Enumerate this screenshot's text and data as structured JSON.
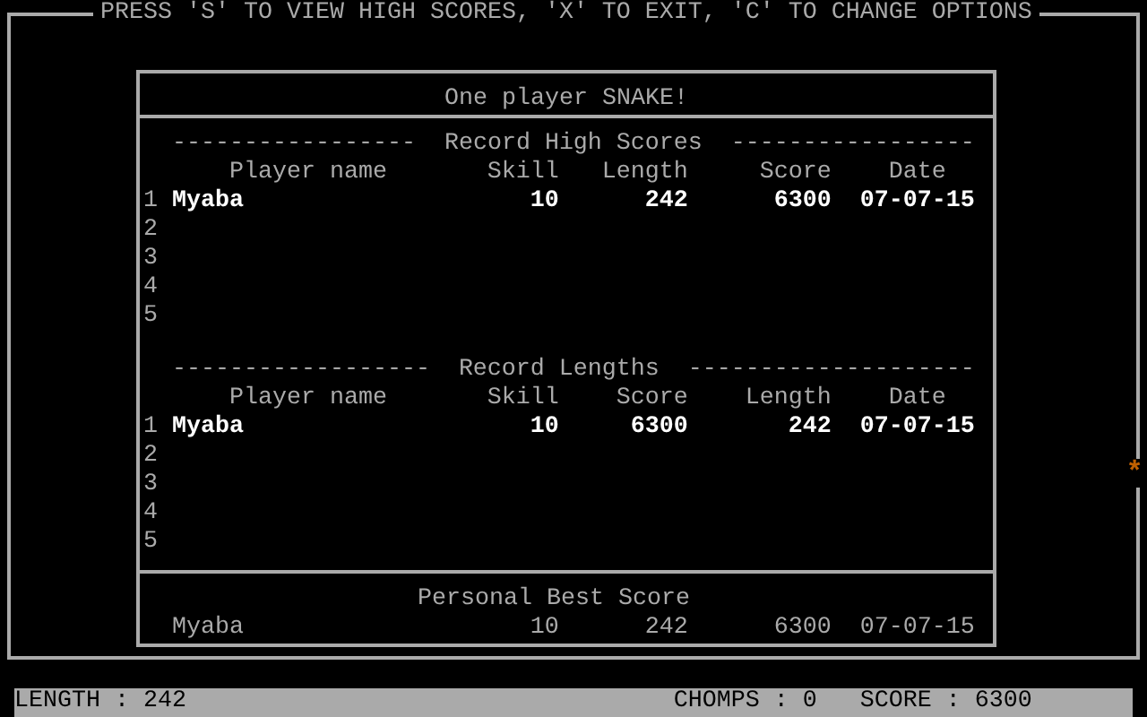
{
  "frame_title": "PRESS 'S' TO VIEW HIGH SCORES, 'X' TO EXIT, 'C' TO CHANGE OPTIONS",
  "panel_title": "One player SNAKE!",
  "tables": [
    {
      "title": "Record High Scores",
      "dashes_left": "-----------------",
      "dashes_right": "-----------------",
      "columns": [
        "Player name",
        "Skill",
        "Length",
        "Score",
        "Date"
      ],
      "rows": [
        {
          "rank": "1",
          "name": "Myaba",
          "cells": [
            "10",
            "242",
            "6300",
            "07-07-15"
          ]
        },
        {
          "rank": "2"
        },
        {
          "rank": "3"
        },
        {
          "rank": "4"
        },
        {
          "rank": "5"
        }
      ]
    },
    {
      "title": "Record Lengths",
      "dashes_left": "------------------",
      "dashes_right": "--------------------",
      "columns": [
        "Player name",
        "Skill",
        "Score",
        "Length",
        "Date"
      ],
      "rows": [
        {
          "rank": "1",
          "name": "Myaba",
          "cells": [
            "10",
            "6300",
            "242",
            "07-07-15"
          ]
        },
        {
          "rank": "2"
        },
        {
          "rank": "3"
        },
        {
          "rank": "4"
        },
        {
          "rank": "5"
        }
      ]
    }
  ],
  "personal_best": {
    "title": "Personal Best Score",
    "name": "Myaba",
    "cells": [
      "10",
      "242",
      "6300",
      "07-07-15"
    ]
  },
  "food_marker": "*",
  "status_bar": [
    "LENGTH : 242",
    "CHOMPS : 0",
    "SCORE : 6300"
  ]
}
